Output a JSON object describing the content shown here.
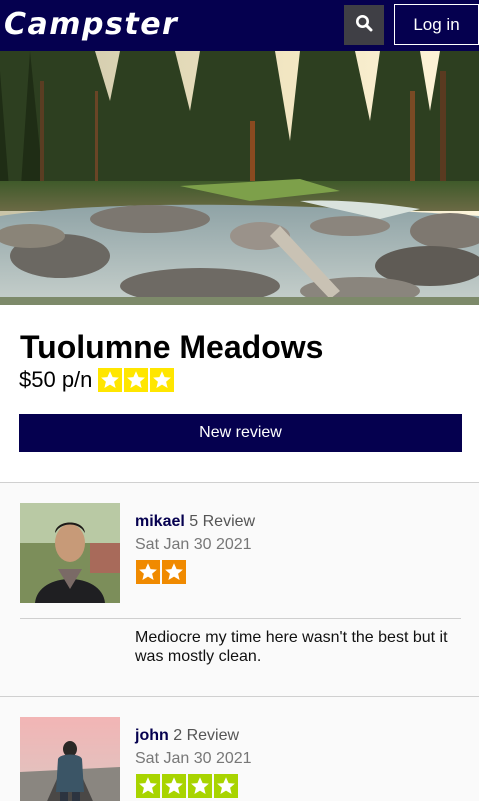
{
  "header": {
    "brand": "Campster",
    "login_label": "Log in",
    "search_icon": "search-icon",
    "background": "#05004f"
  },
  "campground": {
    "name": "Tuolumne Meadows",
    "price": "$50 p/n",
    "rating": 3,
    "rating_max": 3,
    "star_color": "#ffe600",
    "new_review_label": "New review"
  },
  "reviews": [
    {
      "user": "mikael",
      "review_count": "5 Review",
      "date": "Sat Jan 30 2021",
      "rating": 2,
      "star_color": "#f08a00",
      "text": "Mediocre my time here wasn't the best but it was mostly clean."
    },
    {
      "user": "john",
      "review_count": "2 Review",
      "date": "Sat Jan 30 2021",
      "rating": 4,
      "star_color": "#a8d400",
      "text": ""
    }
  ]
}
